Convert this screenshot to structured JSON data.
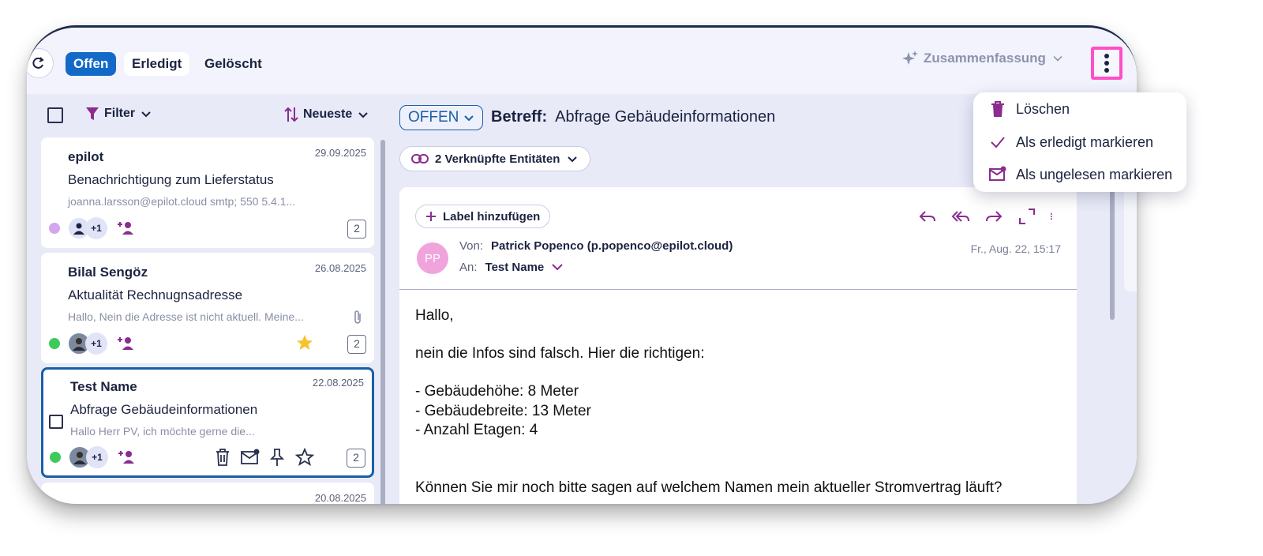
{
  "header": {
    "tabs": [
      {
        "label": "Offen",
        "active": true
      },
      {
        "label": "Erledigt",
        "active": false
      },
      {
        "label": "Gelöscht",
        "active": false
      }
    ],
    "summary_label": "Zusammenfassung"
  },
  "list": {
    "filter_label": "Filter",
    "sort_label": "Neueste",
    "items": [
      {
        "from": "epilot",
        "date": "29.09.2025",
        "subject": "Benachrichtigung zum Lieferstatus",
        "preview": "joanna.larsson@epilot.cloud smtp; 550 5.4.1...",
        "participants_extra": "+1",
        "count": "2",
        "dot_color": "#d4a6f0"
      },
      {
        "from": "Bilal Sengöz",
        "date": "26.08.2025",
        "subject": "Aktualität Rechnugnsadresse",
        "preview": "Hallo, Nein die Adresse ist nicht aktuell. Meine...",
        "participants_extra": "+1",
        "count": "2",
        "dot_color": "#3ecb5a"
      },
      {
        "from": "Test Name",
        "date": "22.08.2025",
        "subject": "Abfrage Gebäudeinformationen",
        "preview": "Hallo Herr PV, ich möchte gerne die...",
        "participants_extra": "+1",
        "count": "2",
        "dot_color": "#3ecb5a"
      },
      {
        "date": "20.08.2025"
      }
    ]
  },
  "thread": {
    "status": "OFFEN",
    "subject_prefix": "Betreff:",
    "subject": "Abfrage Gebäudeinformationen",
    "entities_label": "2 Verknüpfte Entitäten",
    "label_button": "Label hinzufügen",
    "avatar_initials": "PP",
    "from_label": "Von:",
    "from_value": "Patrick Popenco (p.popenco@epilot.cloud)",
    "to_label": "An:",
    "to_value": "Test Name",
    "date": "Fr., Aug. 22, 15:17",
    "body": [
      "Hallo,",
      "nein die Infos sind falsch. Hier die richtigen:",
      "- Gebäudehöhe: 8 Meter",
      "- Gebäudebreite: 13 Meter",
      "- Anzahl Etagen: 4",
      "Können Sie mir noch bitte sagen auf welchem Namen mein aktueller Stromvertrag läuft?"
    ]
  },
  "menu": {
    "items": [
      {
        "label": "Löschen",
        "icon": "trash-icon"
      },
      {
        "label": "Als erledigt markieren",
        "icon": "check-icon"
      },
      {
        "label": "Als ungelesen markieren",
        "icon": "mail-unread-icon"
      }
    ]
  },
  "colors": {
    "primary": "#1369c8",
    "accent_purple": "#8a2d8f",
    "highlight": "#ff4fc8"
  }
}
